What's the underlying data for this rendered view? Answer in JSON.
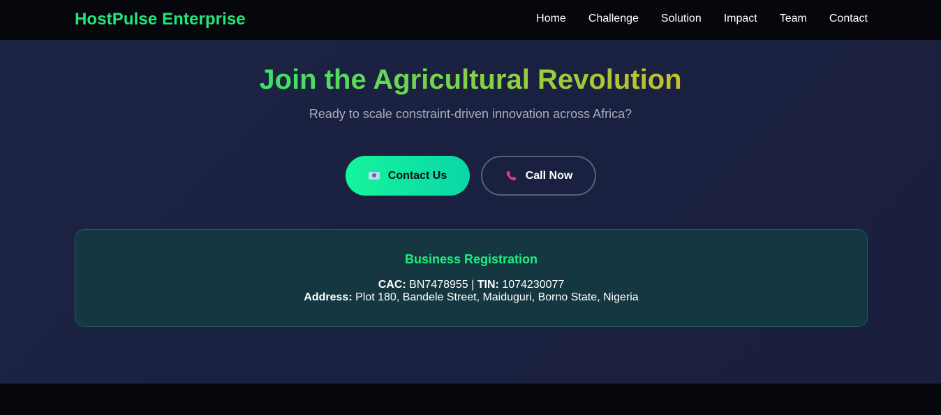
{
  "nav": {
    "brand": "HostPulse Enterprise",
    "links": [
      "Home",
      "Challenge",
      "Solution",
      "Impact",
      "Team",
      "Contact"
    ]
  },
  "hero": {
    "title": "Join the Agricultural Revolution",
    "subtitle": "Ready to scale constraint-driven innovation across Africa?",
    "buttons": {
      "contact": {
        "icon": "email-icon",
        "label": "Contact Us"
      },
      "call": {
        "icon": "phone-icon",
        "label": "Call Now"
      }
    }
  },
  "registration": {
    "title": "Business Registration",
    "cac_label": "CAC:",
    "cac_value": "BN7478955",
    "separator": "|",
    "tin_label": "TIN:",
    "tin_value": "1074230077",
    "address_label": "Address:",
    "address_value": "Plot 180, Bandele Street, Maiduguri, Borno State, Nigeria"
  },
  "colors": {
    "brand": "#20e878",
    "accent_gradient_start": "#14f59a",
    "accent_gradient_end": "#0bd6a6",
    "background": "#1d2342",
    "card_background": "#153741"
  }
}
